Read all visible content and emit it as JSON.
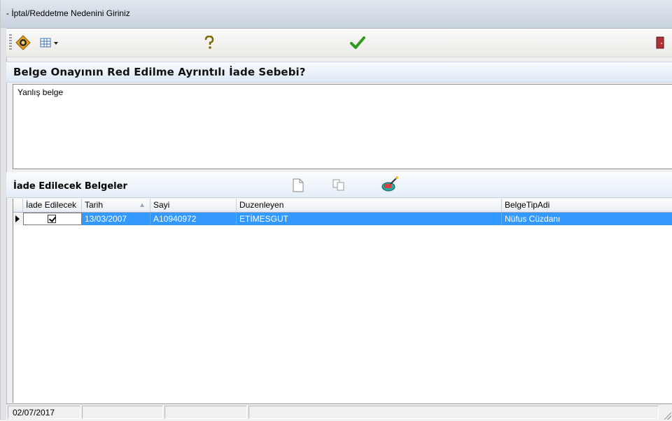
{
  "window": {
    "title": "- İptal/Reddetme Nedenini Giriniz"
  },
  "toolbar": {
    "buttons": [
      {
        "icon": "navigator-icon"
      },
      {
        "icon": "grid-view-icon"
      },
      {
        "icon": "help-icon"
      },
      {
        "icon": "checkmark-icon"
      },
      {
        "icon": "exit-door-icon"
      }
    ]
  },
  "question": "Belge Onayının Red Edilme Ayrıntılı İade Sebebi?",
  "reason_text": "Yanlış belge",
  "documents": {
    "label": "İade Edilecek Belgeler",
    "columns": [
      "İade Edilecek",
      "Tarih",
      "Sayi",
      "Duzenleyen",
      "BelgeTipAdi"
    ],
    "rows": [
      {
        "iade": true,
        "tarih": "13/03/2007",
        "sayi": "A10940972",
        "duzenleyen": "ETİMESGUT",
        "belgetip": "Nüfus Cüzdanı"
      }
    ]
  },
  "status": {
    "date": "02/07/2017"
  },
  "colors": {
    "selection": "#3399ff",
    "check": "#2e9b1e"
  }
}
